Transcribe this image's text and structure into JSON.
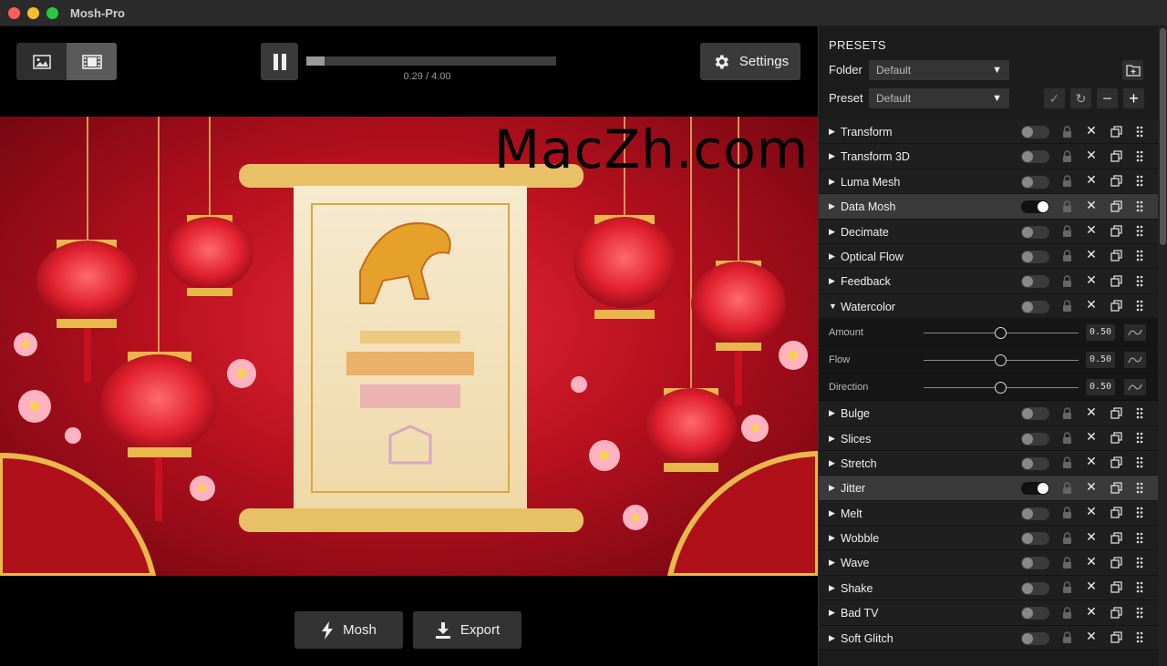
{
  "window": {
    "title": "Mosh-Pro"
  },
  "toolbar": {
    "time": "0.29 / 4.00",
    "progress": 0.0725,
    "settings_label": "Settings"
  },
  "preview": {
    "watermark": "MacZh.com"
  },
  "actions": {
    "mosh_label": "Mosh",
    "export_label": "Export"
  },
  "presets": {
    "title": "PRESETS",
    "folder_label": "Folder",
    "folder_value": "Default",
    "preset_label": "Preset",
    "preset_value": "Default"
  },
  "effects": [
    {
      "name": "Transform",
      "on": false,
      "expanded": false
    },
    {
      "name": "Transform 3D",
      "on": false,
      "expanded": false
    },
    {
      "name": "Luma Mesh",
      "on": false,
      "expanded": false
    },
    {
      "name": "Data Mosh",
      "on": true,
      "expanded": false
    },
    {
      "name": "Decimate",
      "on": false,
      "expanded": false
    },
    {
      "name": "Optical Flow",
      "on": false,
      "expanded": false
    },
    {
      "name": "Feedback",
      "on": false,
      "expanded": false
    },
    {
      "name": "Watercolor",
      "on": false,
      "expanded": true
    },
    {
      "name": "Bulge",
      "on": false,
      "expanded": false
    },
    {
      "name": "Slices",
      "on": false,
      "expanded": false
    },
    {
      "name": "Stretch",
      "on": false,
      "expanded": false
    },
    {
      "name": "Jitter",
      "on": true,
      "expanded": false
    },
    {
      "name": "Melt",
      "on": false,
      "expanded": false
    },
    {
      "name": "Wobble",
      "on": false,
      "expanded": false
    },
    {
      "name": "Wave",
      "on": false,
      "expanded": false
    },
    {
      "name": "Shake",
      "on": false,
      "expanded": false
    },
    {
      "name": "Bad TV",
      "on": false,
      "expanded": false
    },
    {
      "name": "Soft Glitch",
      "on": false,
      "expanded": false
    }
  ],
  "watercolor_params": [
    {
      "label": "Amount",
      "value": "0.50"
    },
    {
      "label": "Flow",
      "value": "0.50"
    },
    {
      "label": "Direction",
      "value": "0.50"
    }
  ],
  "colors": {
    "accent_red": "#e8283a",
    "panel_bg": "#1c1c1c",
    "active_row": "#3a3a3a"
  }
}
